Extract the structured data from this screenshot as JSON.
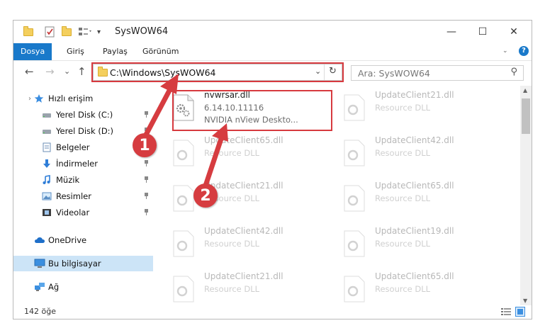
{
  "window": {
    "title": "SysWOW64",
    "controls": {
      "minimize": "—",
      "maximize": "☐",
      "close": "✕"
    }
  },
  "ribbon": {
    "tabs": [
      {
        "label": "Dosya",
        "active": true
      },
      {
        "label": "Giriş",
        "active": false
      },
      {
        "label": "Paylaş",
        "active": false
      },
      {
        "label": "Görünüm",
        "active": false
      }
    ]
  },
  "nav": {
    "back": "←",
    "forward": "→",
    "recent": "⌄",
    "up": "↑",
    "address": "C:\\Windows\\SysWOW64",
    "address_dropdown": "⌄",
    "refresh": "↻",
    "search_placeholder": "Ara: SysWOW64",
    "search_icon": "⚲"
  },
  "sidebar": {
    "items": [
      {
        "label": "Hızlı erişim",
        "icon": "star-icon",
        "pinned": false,
        "selected": false
      },
      {
        "label": "Yerel Disk (C:)",
        "icon": "drive-icon",
        "pinned": true,
        "selected": false
      },
      {
        "label": "Yerel Disk (D:)",
        "icon": "drive-icon",
        "pinned": true,
        "selected": false
      },
      {
        "label": "Belgeler",
        "icon": "documents-icon",
        "pinned": true,
        "selected": false
      },
      {
        "label": "İndirmeler",
        "icon": "download-icon",
        "pinned": true,
        "selected": false
      },
      {
        "label": "Müzik",
        "icon": "music-icon",
        "pinned": true,
        "selected": false
      },
      {
        "label": "Resimler",
        "icon": "pictures-icon",
        "pinned": true,
        "selected": false
      },
      {
        "label": "Videolar",
        "icon": "videos-icon",
        "pinned": true,
        "selected": false
      },
      {
        "label": "OneDrive",
        "icon": "cloud-icon",
        "pinned": false,
        "selected": false
      },
      {
        "label": "Bu bilgisayar",
        "icon": "computer-icon",
        "pinned": false,
        "selected": true
      },
      {
        "label": "Ağ",
        "icon": "network-icon",
        "pinned": false,
        "selected": false
      }
    ]
  },
  "files": [
    {
      "name": "nvwrsar.dll",
      "line2": "6.14.10.11116",
      "line3": "NVIDIA nView Deskto...",
      "highlighted": true
    },
    {
      "name": "UpdateClient21.dll",
      "line2": "Resource DLL",
      "line3": ""
    },
    {
      "name": "UpdateClient65.dll",
      "line2": "Resource DLL",
      "line3": ""
    },
    {
      "name": "UpdateClient42.dll",
      "line2": "Resource DLL",
      "line3": ""
    },
    {
      "name": "UpdateClient21.dll",
      "line2": "Resource DLL",
      "line3": ""
    },
    {
      "name": "UpdateClient65.dll",
      "line2": "Resource DLL",
      "line3": ""
    },
    {
      "name": "UpdateClient42.dll",
      "line2": "Resource DLL",
      "line3": ""
    },
    {
      "name": "UpdateClient19.dll",
      "line2": "Resource DLL",
      "line3": ""
    },
    {
      "name": "UpdateClient21.dll",
      "line2": "Resource DLL",
      "line3": ""
    },
    {
      "name": "UpdateClient65.dll",
      "line2": "Resource DLL",
      "line3": ""
    }
  ],
  "status": {
    "count": "142 öğe"
  },
  "annotations": {
    "callout1": "1",
    "callout2": "2",
    "accent": "#d63c40"
  },
  "colors": {
    "ribbon_active": "#1979ca",
    "selected_bg": "#cce4f7",
    "highlight": "#d73a3f"
  }
}
